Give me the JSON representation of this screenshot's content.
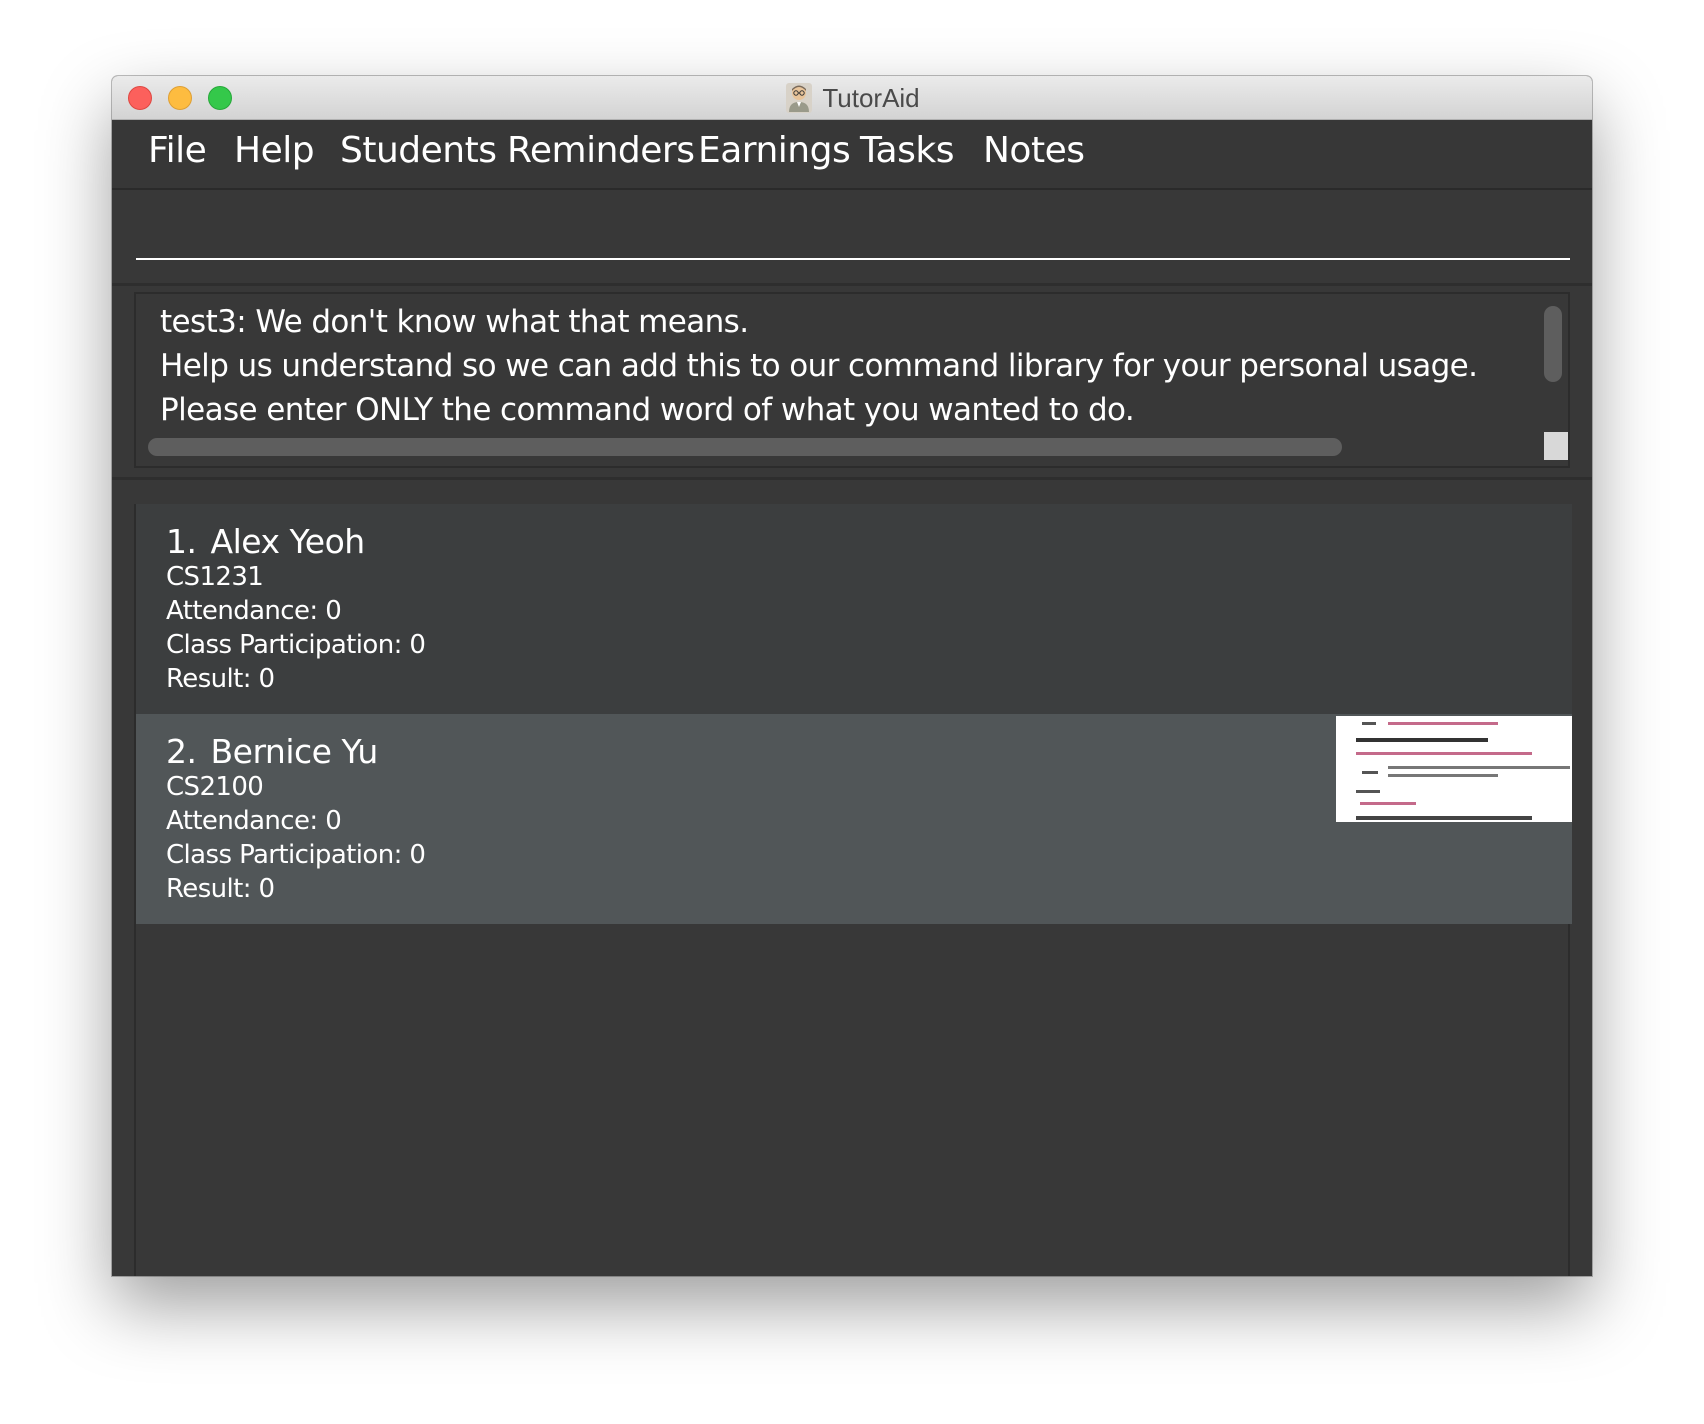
{
  "window": {
    "title": "TutorAid"
  },
  "menu": [
    {
      "label": "File"
    },
    {
      "label": "Help"
    },
    {
      "label": "Students"
    },
    {
      "label": "Reminders"
    },
    {
      "label": "Earnings"
    },
    {
      "label": "Tasks"
    },
    {
      "label": "Notes"
    }
  ],
  "command_box": {
    "value": "",
    "placeholder": ""
  },
  "result_display": {
    "lines": [
      "test3: We don't know what that means.",
      "Help us understand so we can add this to our command library for your personal usage.",
      "Please enter ONLY the command word of what you wanted to do."
    ]
  },
  "students": [
    {
      "index": "1.",
      "name": "Alex Yeoh",
      "module": "CS1231",
      "attendance": "Attendance: 0",
      "participation": "Class Participation: 0",
      "result": "Result: 0"
    },
    {
      "index": "2.",
      "name": "Bernice Yu",
      "module": "CS2100",
      "attendance": "Attendance: 0",
      "participation": "Class Participation: 0",
      "result": "Result: 0"
    }
  ],
  "colors": {
    "background": "#383838",
    "card_odd": "#3c3e3f",
    "card_even": "#515658",
    "text": "#ffffff",
    "close_button": "#fc605c",
    "minimize_button": "#fdbc40",
    "zoom_button": "#34c84a"
  },
  "icons": {
    "app": "tutor-avatar-icon",
    "student_photo": "student-photo-thumbnail"
  }
}
